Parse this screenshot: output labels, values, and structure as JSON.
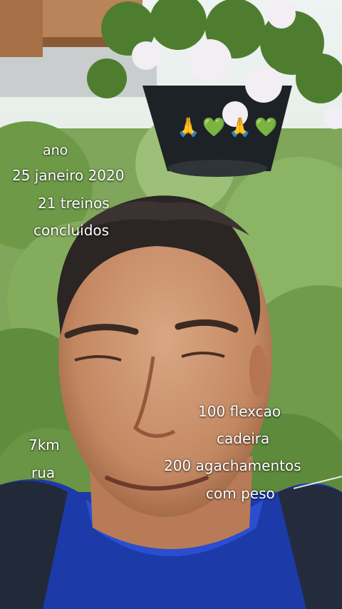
{
  "overlay": {
    "year": "ano",
    "date": "25 janeiro 2020",
    "workouts_line1": "21 treinos",
    "workouts_line2": "concluidos",
    "run_line1": "7km",
    "run_line2": "rua",
    "ex_line1": "100 flexcao",
    "ex_line2": "cadeira",
    "ex_line3": "200 agachamentos",
    "ex_line4": "com peso"
  },
  "stickers": [
    "🙏",
    "💚",
    "🙏",
    "💚"
  ],
  "colors": {
    "foliage": "#6f9a4c",
    "shirt": "#1d3fb2",
    "skin": "#c98e6b",
    "eave": "#b07a4d"
  }
}
